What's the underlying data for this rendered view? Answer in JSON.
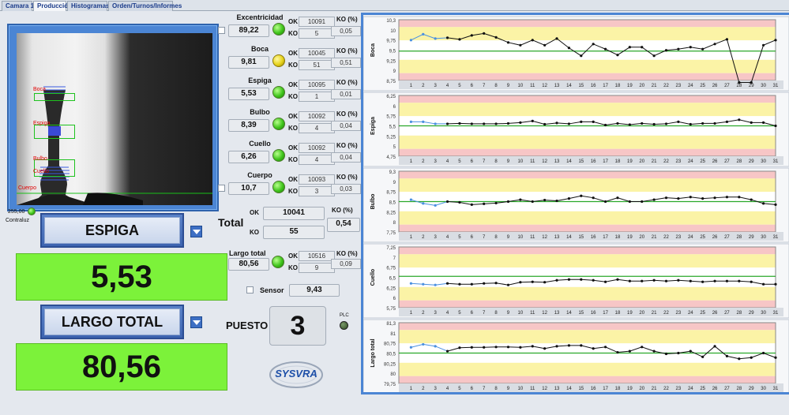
{
  "tabs": [
    "Camara 1",
    "Producción",
    "Histogramas",
    "Orden/Turnos/Informes"
  ],
  "active_tab": 1,
  "camera": {
    "overlays": [
      "Boca",
      "Espiga",
      "Bulbo",
      "Cuello",
      "Cuerpo"
    ],
    "light_value": "255,00",
    "light_label": "Contraluz"
  },
  "measures": [
    {
      "name": "Excentricidad",
      "value": "89,22",
      "ok": "10091",
      "ko": "5",
      "ko_pct": "0,05",
      "led": "green"
    },
    {
      "name": "Boca",
      "value": "9,81",
      "ok": "10045",
      "ko": "51",
      "ko_pct": "0,51",
      "led": "yellow"
    },
    {
      "name": "Espiga",
      "value": "5,53",
      "ok": "10095",
      "ko": "1",
      "ko_pct": "0,01",
      "led": "green"
    },
    {
      "name": "Bulbo",
      "value": "8,39",
      "ok": "10092",
      "ko": "4",
      "ko_pct": "0,04",
      "led": "green"
    },
    {
      "name": "Cuello",
      "value": "6,26",
      "ok": "10092",
      "ko": "4",
      "ko_pct": "0,04",
      "led": "green"
    },
    {
      "name": "Cuerpo",
      "value": "10,7",
      "ok": "10093",
      "ko": "3",
      "ko_pct": "0,03",
      "led": "green"
    }
  ],
  "labels": {
    "ok": "OK",
    "ko": "KO",
    "ko_pct": "KO (%)"
  },
  "total": {
    "label": "Total",
    "ok": "10041",
    "ko": "55",
    "ko_pct": "0,54"
  },
  "largo": {
    "name": "Largo total",
    "value": "80,56",
    "ok": "10516",
    "ko": "9",
    "ko_pct": "0,09"
  },
  "sensor": {
    "label": "Sensor",
    "value": "9,43"
  },
  "puesto": {
    "label": "PUESTO",
    "value": "3"
  },
  "plc": "PLC",
  "logo": "SYSVRA",
  "selector1": {
    "label": "ESPIGA",
    "value": "5,53"
  },
  "selector2": {
    "label": "LARGO TOTAL",
    "value": "80,56"
  },
  "colors": {
    "green_bg": "#7cf23a",
    "band_red": "#f7c6c6",
    "band_yellow": "#fbf3a6",
    "center_line": "#2aa82a"
  },
  "chart_data": [
    {
      "type": "line",
      "name": "Boca",
      "ylabel": "Boca",
      "yticks": [
        "10,3",
        "10",
        "9,75",
        "9,5",
        "9,25",
        "9",
        "8,75"
      ],
      "ylim": [
        8.75,
        10.3
      ],
      "center": 9.5,
      "x": [
        1,
        30
      ],
      "xticks": [
        1,
        2,
        3,
        4,
        5,
        6,
        7,
        8,
        9,
        10,
        11,
        12,
        13,
        14,
        15,
        16,
        17,
        18,
        19,
        20,
        21,
        22,
        23,
        24,
        25,
        26,
        27,
        28,
        29,
        30,
        31
      ],
      "series": [
        {
          "values": [
            9.78,
            9.93,
            9.82,
            9.84,
            9.8,
            9.9,
            9.95,
            9.85,
            9.72,
            9.65,
            9.78,
            9.65,
            9.82,
            9.58,
            9.38,
            9.68,
            9.55,
            9.4,
            9.6,
            9.6,
            9.38,
            9.52,
            9.55,
            9.6,
            9.55,
            9.68,
            9.8,
            8.7,
            8.7,
            9.65,
            9.78
          ]
        }
      ]
    },
    {
      "type": "line",
      "name": "Espiga",
      "ylabel": "Espiga",
      "yticks": [
        "6,25",
        "6",
        "5,75",
        "5,5",
        "5,25",
        "5",
        "4,75"
      ],
      "ylim": [
        4.75,
        6.25
      ],
      "center": 5.5,
      "series": [
        {
          "values": [
            5.6,
            5.6,
            5.55,
            5.55,
            5.56,
            5.55,
            5.55,
            5.55,
            5.56,
            5.58,
            5.62,
            5.54,
            5.57,
            5.55,
            5.6,
            5.6,
            5.52,
            5.56,
            5.53,
            5.56,
            5.54,
            5.55,
            5.6,
            5.54,
            5.56,
            5.56,
            5.6,
            5.65,
            5.58,
            5.58,
            5.5
          ]
        }
      ]
    },
    {
      "type": "line",
      "name": "Bulbo",
      "ylabel": "Bulbo",
      "yticks": [
        "9,3",
        "9",
        "8,75",
        "8,5",
        "8,25",
        "8",
        "7,75"
      ],
      "ylim": [
        7.7,
        9.3
      ],
      "center": 8.5,
      "series": [
        {
          "values": [
            8.55,
            8.45,
            8.4,
            8.5,
            8.48,
            8.42,
            8.44,
            8.46,
            8.5,
            8.55,
            8.5,
            8.54,
            8.52,
            8.58,
            8.65,
            8.6,
            8.5,
            8.6,
            8.5,
            8.5,
            8.55,
            8.6,
            8.58,
            8.62,
            8.58,
            8.6,
            8.62,
            8.62,
            8.55,
            8.45,
            8.42
          ]
        }
      ]
    },
    {
      "type": "line",
      "name": "Cuello",
      "ylabel": "Cuello",
      "yticks": [
        "7,25",
        "7",
        "6,75",
        "6,5",
        "6,25",
        "6",
        "5,75"
      ],
      "ylim": [
        5.7,
        7.25
      ],
      "center": 6.5,
      "series": [
        {
          "values": [
            6.32,
            6.3,
            6.28,
            6.32,
            6.3,
            6.3,
            6.32,
            6.33,
            6.28,
            6.35,
            6.36,
            6.35,
            6.4,
            6.42,
            6.42,
            6.4,
            6.36,
            6.42,
            6.38,
            6.38,
            6.4,
            6.38,
            6.4,
            6.38,
            6.36,
            6.38,
            6.38,
            6.38,
            6.36,
            6.3,
            6.3
          ]
        }
      ]
    },
    {
      "type": "line",
      "name": "Largo total",
      "ylabel": "Largo total",
      "yticks": [
        "81,3",
        "81",
        "80,75",
        "80,5",
        "80,25",
        "80",
        "79,75"
      ],
      "ylim": [
        79.7,
        81.3
      ],
      "center": 80.5,
      "series": [
        {
          "values": [
            80.65,
            80.73,
            80.68,
            80.55,
            80.64,
            80.65,
            80.65,
            80.66,
            80.66,
            80.65,
            80.68,
            80.62,
            80.68,
            80.7,
            80.7,
            80.62,
            80.66,
            80.52,
            80.55,
            80.66,
            80.55,
            80.48,
            80.5,
            80.55,
            80.4,
            80.68,
            80.42,
            80.35,
            80.38,
            80.5,
            80.38
          ]
        }
      ]
    }
  ]
}
